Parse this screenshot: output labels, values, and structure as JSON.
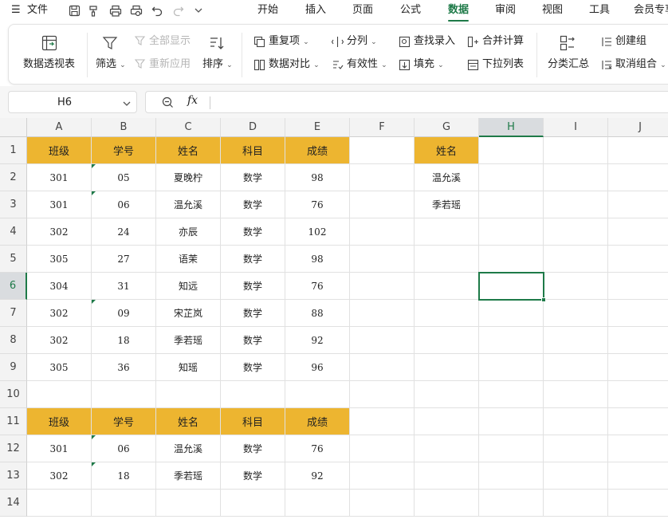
{
  "menu": {
    "file": "文件",
    "tabs": [
      "开始",
      "插入",
      "页面",
      "公式",
      "数据",
      "审阅",
      "视图",
      "工具",
      "会员专享"
    ],
    "active_tab": "数据"
  },
  "ribbon": {
    "pivot": "数据透视表",
    "filter": "筛选",
    "show_all": "全部显示",
    "reapply": "重新应用",
    "sort": "排序",
    "duplicates": "重复项",
    "compare": "数据对比",
    "split": "分列",
    "validity": "有效性",
    "find_input": "查找录入",
    "fill": "填充",
    "consolidate": "合并计算",
    "dropdown_list": "下拉列表",
    "subtotal": "分类汇总",
    "group": "创建组",
    "ungroup": "取消组合"
  },
  "formula_bar": {
    "cell_ref": "H6",
    "fx": "fx",
    "formula": ""
  },
  "sheet": {
    "columns": [
      "A",
      "B",
      "C",
      "D",
      "E",
      "F",
      "G",
      "H",
      "I",
      "J"
    ],
    "rows": [
      "1",
      "2",
      "3",
      "4",
      "5",
      "6",
      "7",
      "8",
      "9",
      "10",
      "11",
      "12",
      "13",
      "14"
    ],
    "selected_col": "H",
    "selected_row": "6",
    "table1_header": [
      "班级",
      "学号",
      "姓名",
      "科目",
      "成绩"
    ],
    "table1_rows": [
      [
        "301",
        "05",
        "夏晚柠",
        "数学",
        "98"
      ],
      [
        "301",
        "06",
        "温允溪",
        "数学",
        "76"
      ],
      [
        "302",
        "24",
        "亦辰",
        "数学",
        "102"
      ],
      [
        "305",
        "27",
        "语茉",
        "数学",
        "98"
      ],
      [
        "304",
        "31",
        "知远",
        "数学",
        "76"
      ],
      [
        "302",
        "09",
        "宋芷岚",
        "数学",
        "88"
      ],
      [
        "302",
        "18",
        "季若瑶",
        "数学",
        "92"
      ],
      [
        "305",
        "36",
        "知瑶",
        "数学",
        "96"
      ]
    ],
    "lookup_header": "姓名",
    "lookup_values": [
      "温允溪",
      "季若瑶"
    ],
    "table2_header": [
      "班级",
      "学号",
      "姓名",
      "科目",
      "成绩"
    ],
    "table2_rows": [
      [
        "301",
        "06",
        "温允溪",
        "数学",
        "76"
      ],
      [
        "302",
        "18",
        "季若瑶",
        "数学",
        "92"
      ]
    ]
  },
  "colors": {
    "accent": "#1e7a48",
    "header_fill": "#edb530"
  }
}
